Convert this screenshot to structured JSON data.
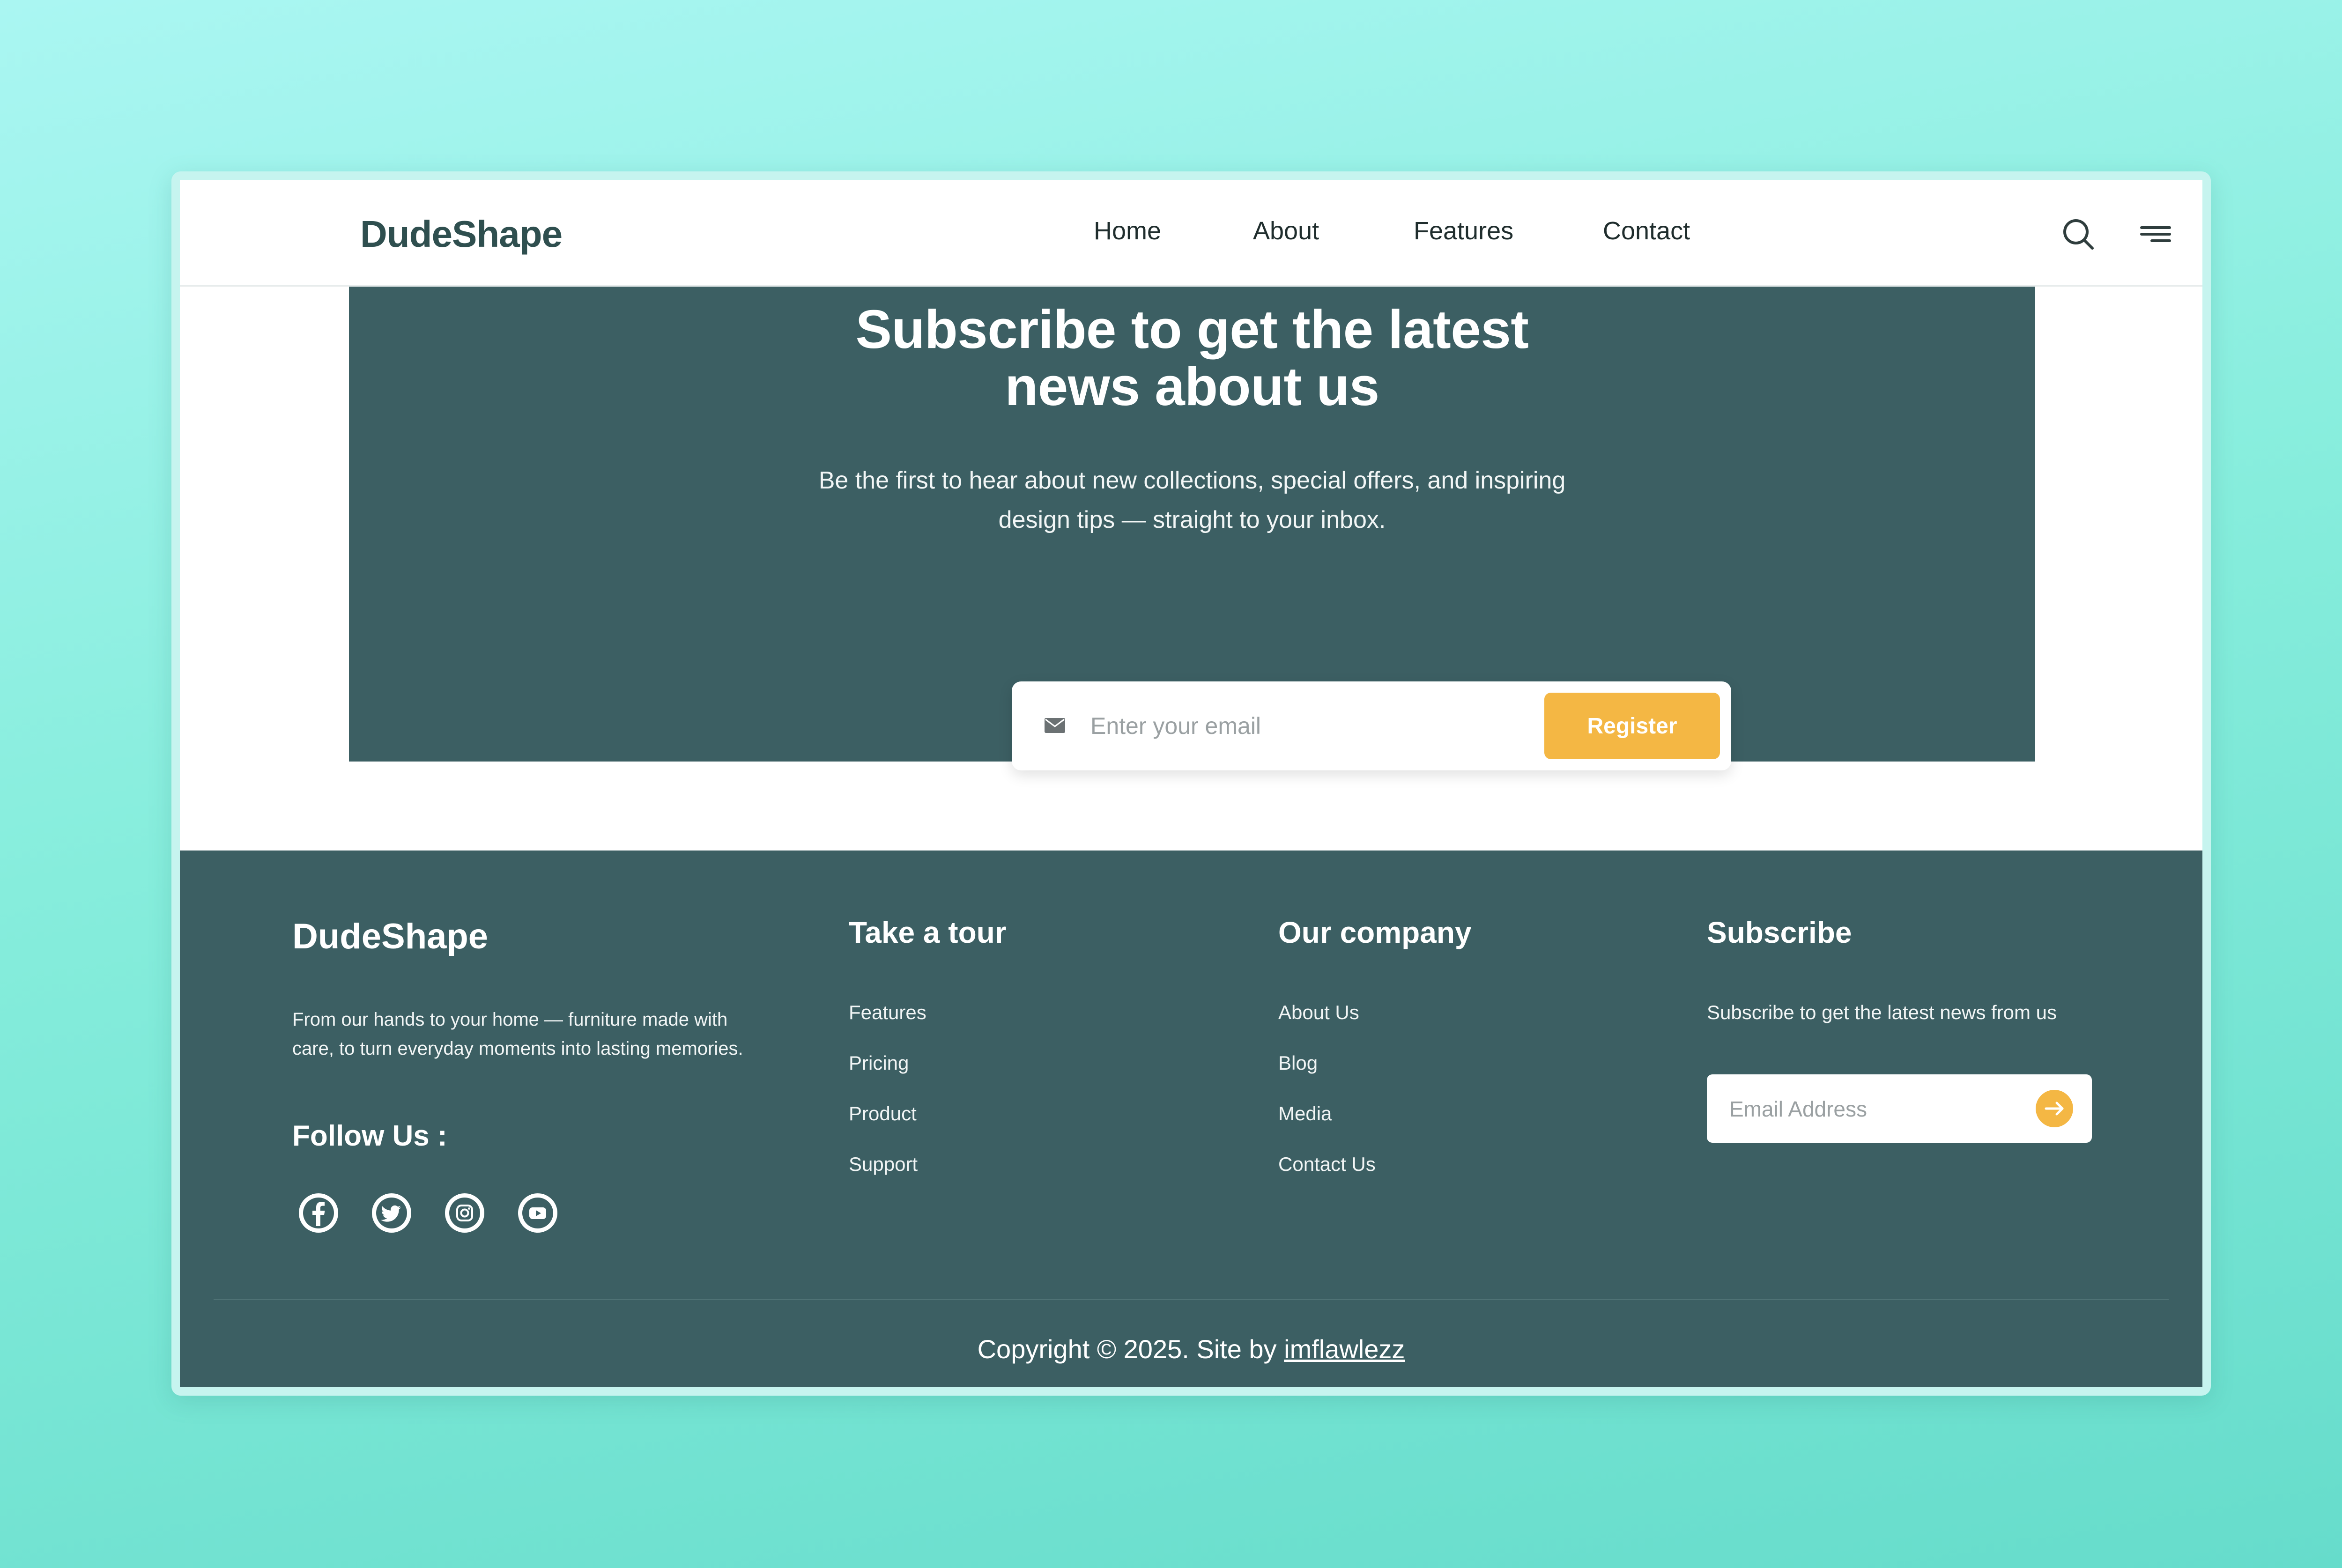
{
  "header": {
    "logo": "DudeShape",
    "nav": [
      "Home",
      "About",
      "Features",
      "Contact"
    ],
    "icons": [
      "search-icon",
      "menu-icon"
    ]
  },
  "hero": {
    "title_line1": "Subscribe to get the latest",
    "title_line2": "news about us",
    "desc_line1": "Be the first to hear about new collections, special offers, and inspiring",
    "desc_line2": "design tips — straight to your inbox.",
    "email_placeholder": "Enter your email",
    "register_label": "Register",
    "mail_icon": "mail-icon"
  },
  "footer": {
    "brand": "DudeShape",
    "text_line1": "From our hands to your home — furniture made with",
    "text_line2": "care, to turn everyday moments into lasting memories.",
    "follow_title": "Follow Us :",
    "socials": [
      "facebook-icon",
      "twitter-icon",
      "instagram-icon",
      "youtube-icon"
    ],
    "tour": {
      "title": "Take a tour",
      "items": [
        "Features",
        "Pricing",
        "Product",
        "Support"
      ]
    },
    "company": {
      "title": "Our company",
      "items": [
        "About Us",
        "Blog",
        "Media",
        "Contact Us"
      ]
    },
    "subscribe": {
      "title": "Subscribe",
      "text": "Subscribe to get the latest news from us",
      "placeholder": "Email Address",
      "button_icon": "arrow-right-icon"
    },
    "copyright_prefix": "Copyright © 2025. Site by",
    "copyright_link": "imflawlezz"
  },
  "colors": {
    "primary_dark": "#3c5f63",
    "accent": "#f4b744",
    "logo_text": "#2f4f4f",
    "background_gradient_start": "#aaf6f2",
    "background_gradient_end": "#66dccb"
  }
}
